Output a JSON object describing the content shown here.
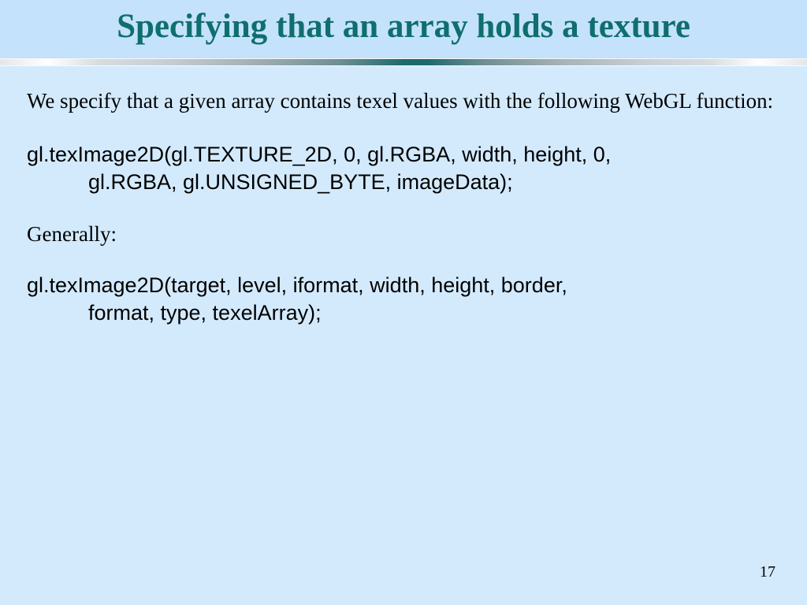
{
  "title": "Specifying that an array holds a texture",
  "intro": "We specify that a given array contains texel values with the following WebGL function:",
  "code1_line1": "gl.texImage2D(gl.TEXTURE_2D, 0, gl.RGBA, width, height, 0,",
  "code1_line2": "gl.RGBA, gl.UNSIGNED_BYTE, imageData);",
  "generally": "Generally:",
  "code2_line1": "gl.texImage2D(target, level, iformat, width, height, border,",
  "code2_line2": "format, type, texelArray);",
  "page_number": "17"
}
